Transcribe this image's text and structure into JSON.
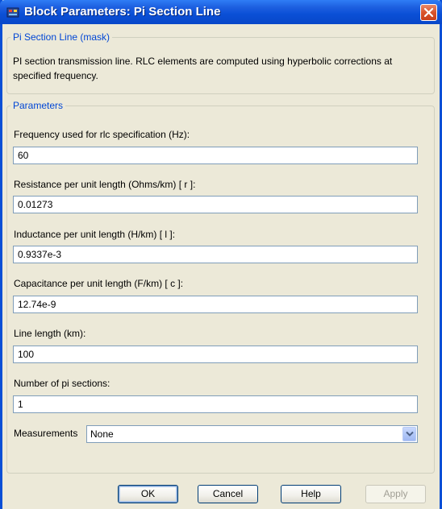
{
  "window": {
    "title": "Block Parameters: Pi Section Line"
  },
  "mask_group": {
    "legend": "Pi Section Line (mask)",
    "description": "PI section transmission line. RLC elements are computed using hyperbolic corrections at specified frequency."
  },
  "params_group": {
    "legend": "Parameters",
    "fields": [
      {
        "label": "Frequency used for rlc specification (Hz):",
        "value": "60"
      },
      {
        "label": "Resistance per unit length (Ohms/km) [ r ]:",
        "value": "0.01273"
      },
      {
        "label": "Inductance per unit length (H/km) [ l ]:",
        "value": "0.9337e-3"
      },
      {
        "label": "Capacitance per unit length (F/km) [ c ]:",
        "value": "12.74e-9"
      },
      {
        "label": "Line length (km):",
        "value": "100"
      },
      {
        "label": "Number of pi sections:",
        "value": "1"
      }
    ],
    "measurements": {
      "label": "Measurements",
      "selected": "None"
    }
  },
  "buttons": {
    "ok": "OK",
    "cancel": "Cancel",
    "help": "Help",
    "apply": "Apply"
  },
  "icons": {
    "title": "simulink-block-icon",
    "close": "close-icon",
    "dropdown": "chevron-down-icon"
  }
}
